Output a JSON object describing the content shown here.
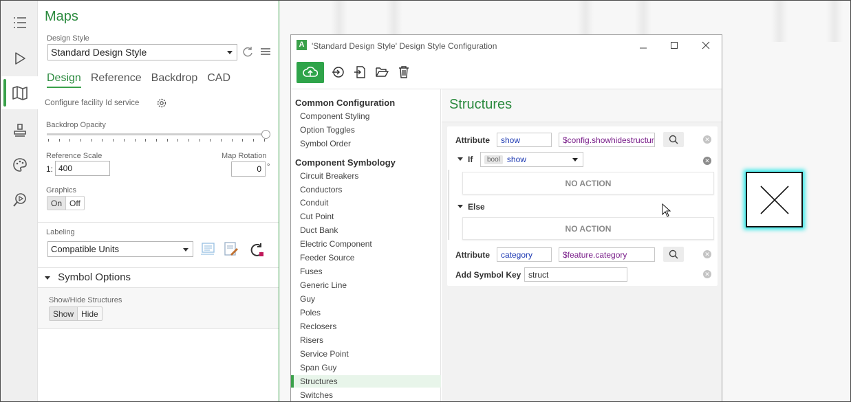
{
  "rail": {
    "icons": [
      "list-icon",
      "play-icon",
      "map-icon",
      "stamp-icon",
      "palette-icon",
      "search-location-icon"
    ]
  },
  "maps_panel": {
    "title": "Maps",
    "design_style_label": "Design Style",
    "design_style_value": "Standard Design Style",
    "tabs": [
      "Design",
      "Reference",
      "Backdrop",
      "CAD"
    ],
    "active_tab": "Design",
    "facility_label": "Configure facility Id service",
    "backdrop_opacity_label": "Backdrop Opacity",
    "reference_scale_label": "Reference Scale",
    "reference_scale_prefix": "1:",
    "reference_scale_value": "400",
    "map_rotation_label": "Map Rotation",
    "map_rotation_value": "0",
    "map_rotation_unit": "°",
    "graphics_label": "Graphics",
    "graphics_on": "On",
    "graphics_off": "Off",
    "labeling_label": "Labeling",
    "labeling_value": "Compatible Units",
    "symbol_options_title": "Symbol Options",
    "show_hide_label": "Show/Hide Structures",
    "show_label": "Show",
    "hide_label": "Hide"
  },
  "dialog": {
    "title": "'Standard Design Style' Design Style Configuration",
    "nav": {
      "groups": [
        {
          "label": "Common Configuration",
          "items": [
            "Component Styling",
            "Option Toggles",
            "Symbol Order"
          ]
        },
        {
          "label": "Component Symbology",
          "items": [
            "Circuit Breakers",
            "Conductors",
            "Conduit",
            "Cut Point",
            "Duct Bank",
            "Electric Component",
            "Feeder Source",
            "Fuses",
            "Generic Line",
            "Guy",
            "Poles",
            "Reclosers",
            "Risers",
            "Service Point",
            "Span Guy",
            "Structures",
            "Switches"
          ]
        }
      ],
      "selected": "Structures"
    },
    "content": {
      "title": "Structures",
      "attr1_label": "Attribute",
      "attr1_value": "show",
      "attr1_expr": "$config.showhidestructur",
      "if_label": "If",
      "if_tag": "bool",
      "if_value": "show",
      "no_action_1": "NO ACTION",
      "else_label": "Else",
      "no_action_2": "NO ACTION",
      "attr2_label": "Attribute",
      "attr2_value": "category",
      "attr2_expr": "$feature.category",
      "symbol_key_label": "Add Symbol Key",
      "symbol_key_value": "struct"
    }
  },
  "colors": {
    "accent": "#3aa14a",
    "title_green": "#2b8a3e",
    "highlight": "#2ee6e6"
  }
}
